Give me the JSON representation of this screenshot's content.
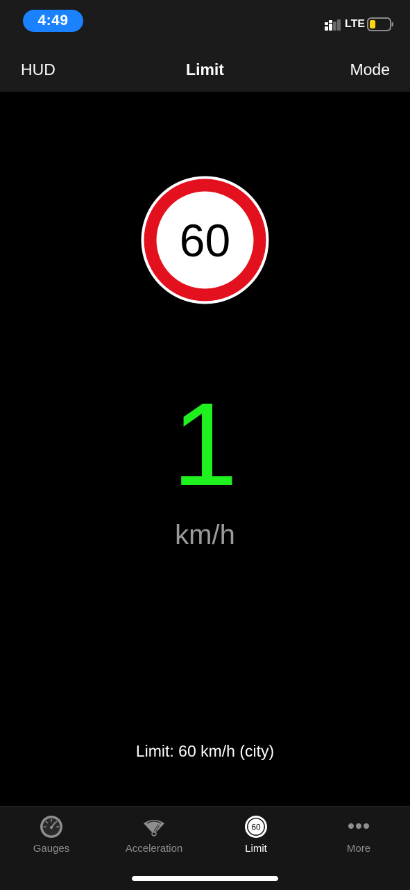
{
  "status_bar": {
    "time": "4:49",
    "network": "LTE",
    "accent_color": "#1a82ff",
    "battery_color": "#ffd60a",
    "battery_level": 0.3
  },
  "nav": {
    "left_label": "HUD",
    "title": "Limit",
    "right_label": "Mode"
  },
  "speed_sign": {
    "value": "60",
    "ring_color": "#e3101e"
  },
  "speed": {
    "value": "1",
    "unit": "km/h",
    "color": "#1ef11e"
  },
  "limit_info": "Limit: 60 km/h (city)",
  "tabs": [
    {
      "label": "Gauges",
      "icon": "gauge-icon",
      "active": false
    },
    {
      "label": "Acceleration",
      "icon": "acceleration-icon",
      "active": false
    },
    {
      "label": "Limit",
      "icon": "speed-limit-icon",
      "icon_text": "60",
      "active": true
    },
    {
      "label": "More",
      "icon": "more-icon",
      "active": false
    }
  ]
}
